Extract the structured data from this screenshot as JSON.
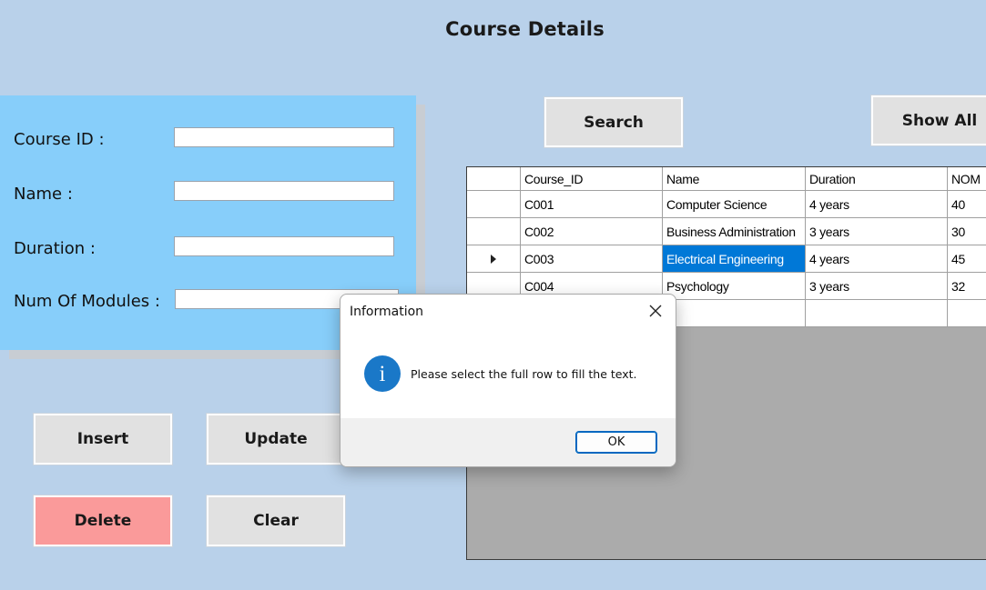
{
  "header": {
    "title": "Course Details"
  },
  "form": {
    "course_id_label": "Course ID :",
    "name_label": "Name :",
    "duration_label": "Duration :",
    "modules_label": "Num Of Modules :",
    "course_id_value": "",
    "name_value": "",
    "duration_value": "",
    "modules_value": ""
  },
  "buttons": {
    "search": "Search",
    "show_all": "Show All",
    "insert": "Insert",
    "update": "Update",
    "delete": "Delete",
    "clear": "Clear"
  },
  "colors": {
    "delete_button": "#fa9a9a",
    "form_panel": "#87cefa",
    "selection": "#0078d7"
  },
  "grid": {
    "columns": [
      "Course_ID",
      "Name",
      "Duration",
      "NOM"
    ],
    "rows": [
      [
        "C001",
        "Computer Science",
        "4 years",
        "40"
      ],
      [
        "C002",
        "Business Administration",
        "3 years",
        "30"
      ],
      [
        "C003",
        "Electrical Engineering",
        "4 years",
        "45"
      ],
      [
        "C004",
        "Psychology",
        "3 years",
        "32"
      ]
    ],
    "current_row_indicator": "arrow-right-icon"
  },
  "dialog": {
    "title": "Information",
    "message": "Please select the full row to fill the text.",
    "ok": "OK",
    "icon": "info-icon"
  }
}
